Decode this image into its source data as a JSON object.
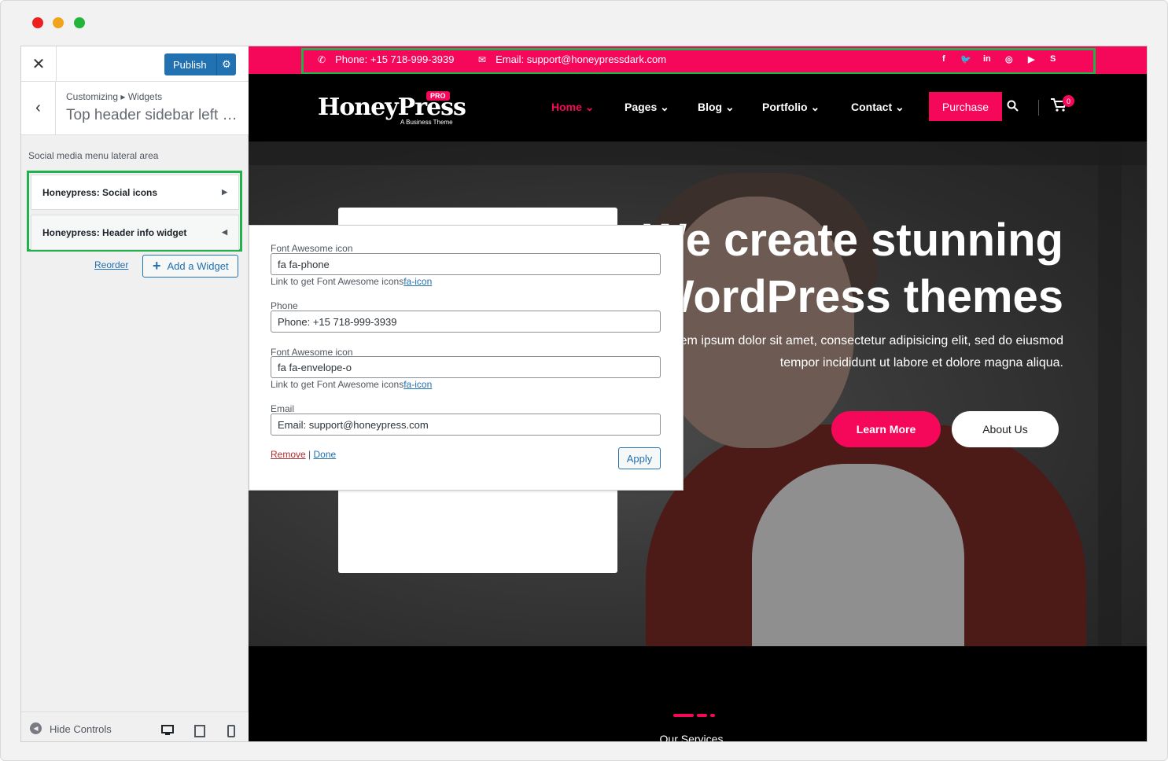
{
  "panel": {
    "publish_label": "Publish",
    "breadcrumb": "Customizing ▸ Widgets",
    "title": "Top header sidebar left ar...",
    "area_description": "Social media menu lateral area",
    "widgets": [
      "Honeypress: Social icons",
      "Honeypress: Header info widget"
    ],
    "reorder_label": "Reorder",
    "add_widget_label": "Add a Widget",
    "hide_controls_label": "Hide Controls"
  },
  "topbar": {
    "phone": "Phone: +15 718-999-3939",
    "email": "Email: support@honeypressdark.com",
    "social_icons": [
      "facebook-icon",
      "twitter-icon",
      "linkedin-icon",
      "instagram-icon",
      "youtube-icon",
      "skype-icon"
    ]
  },
  "header": {
    "logo": "HoneyPress",
    "logo_badge": "PRO",
    "logo_tagline": "A Business Theme",
    "nav": [
      "Home",
      "Pages",
      "Blog",
      "Portfolio",
      "Contact"
    ],
    "purchase_label": "Purchase",
    "cart_count": "0"
  },
  "hero": {
    "line1": "We create stunning",
    "line2": "WordPress themes",
    "para1": "Lorem ipsum dolor sit amet, consectetur adipisicing elit, sed do eiusmod",
    "para2": "tempor incididunt ut labore et dolore magna aliqua.",
    "learn_more": "Learn More",
    "about_us": "About Us"
  },
  "services": {
    "heading": "Our Services"
  },
  "form": {
    "label_icon1": "Font Awesome icon",
    "value_icon1": "fa fa-phone",
    "help_prefix": "Link to get Font Awesome icons",
    "help_link": "fa-icon",
    "label_phone": "Phone",
    "value_phone": "Phone: +15 718-999-3939",
    "label_icon2": "Font Awesome icon",
    "value_icon2": "fa fa-envelope-o",
    "label_email": "Email",
    "value_email": "Email: support@honeypress.com",
    "remove_label": "Remove",
    "separator": "|",
    "done_label": "Done",
    "apply_label": "Apply"
  },
  "colors": {
    "accent": "#f5075a",
    "highlight": "#22b14c",
    "wp_blue": "#2271b1"
  }
}
